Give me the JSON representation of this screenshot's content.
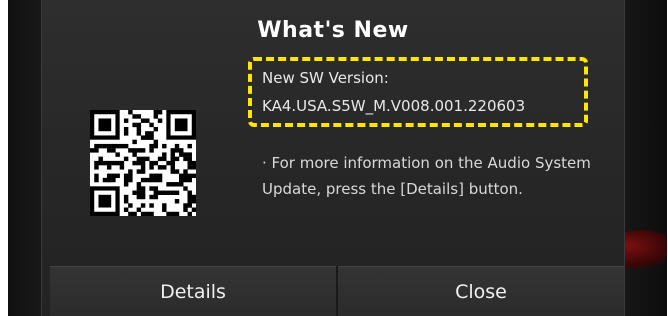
{
  "dialog": {
    "title": "What's New",
    "version_label": "New SW Version:",
    "version_value": "KA4.USA.S5W_M.V008.001.220603",
    "info_text": "· For more information on the Audio System Update, press the [Details] button."
  },
  "buttons": {
    "details_label": "Details",
    "close_label": "Close"
  },
  "colors": {
    "highlight": "#ffe600",
    "dialog_bg": "#2a2a2a",
    "text": "#ffffff"
  },
  "icons": {
    "qr": "qr-code-icon"
  }
}
